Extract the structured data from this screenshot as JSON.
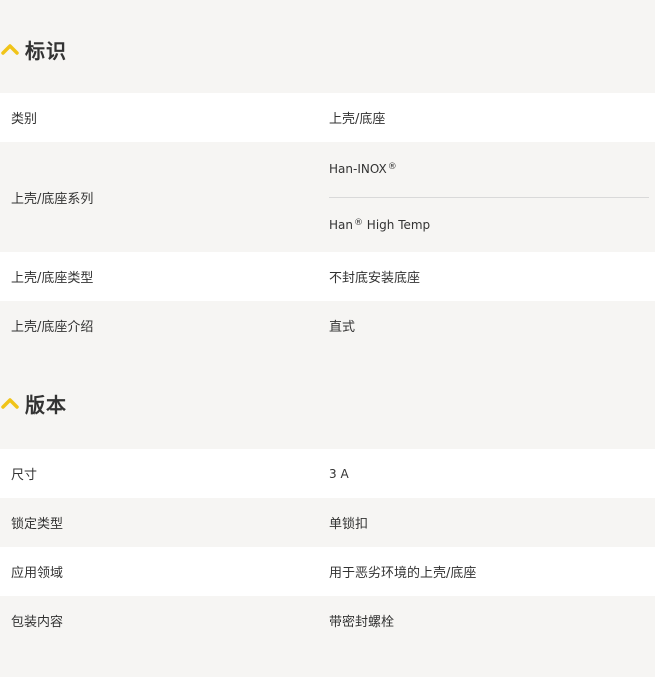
{
  "sections": [
    {
      "title": "标识",
      "rows": [
        {
          "label": "类别",
          "values": [
            "上壳/底座"
          ]
        },
        {
          "label": "上壳/底座系列",
          "values": [
            {
              "text": "Han-INOX",
              "sup": "®"
            },
            {
              "text": "Han",
              "sup": "®",
              "suffix": " High Temp"
            }
          ]
        },
        {
          "label": "上壳/底座类型",
          "values": [
            "不封底安装底座"
          ]
        },
        {
          "label": "上壳/底座介绍",
          "values": [
            "直式"
          ]
        }
      ]
    },
    {
      "title": "版本",
      "rows": [
        {
          "label": "尺寸",
          "values": [
            "3 A"
          ]
        },
        {
          "label": "锁定类型",
          "values": [
            "单锁扣"
          ]
        },
        {
          "label": "应用领域",
          "values": [
            "用于恶劣环境的上壳/底座"
          ]
        },
        {
          "label": "包装内容",
          "values": [
            "带密封螺栓"
          ]
        }
      ]
    }
  ],
  "colors": {
    "accent": "#f0c419",
    "row_alt": "#ffffff",
    "background": "#f6f5f3",
    "divider": "#d9d9d9"
  },
  "icons": {
    "section_toggle": "chevron-up-icon"
  }
}
